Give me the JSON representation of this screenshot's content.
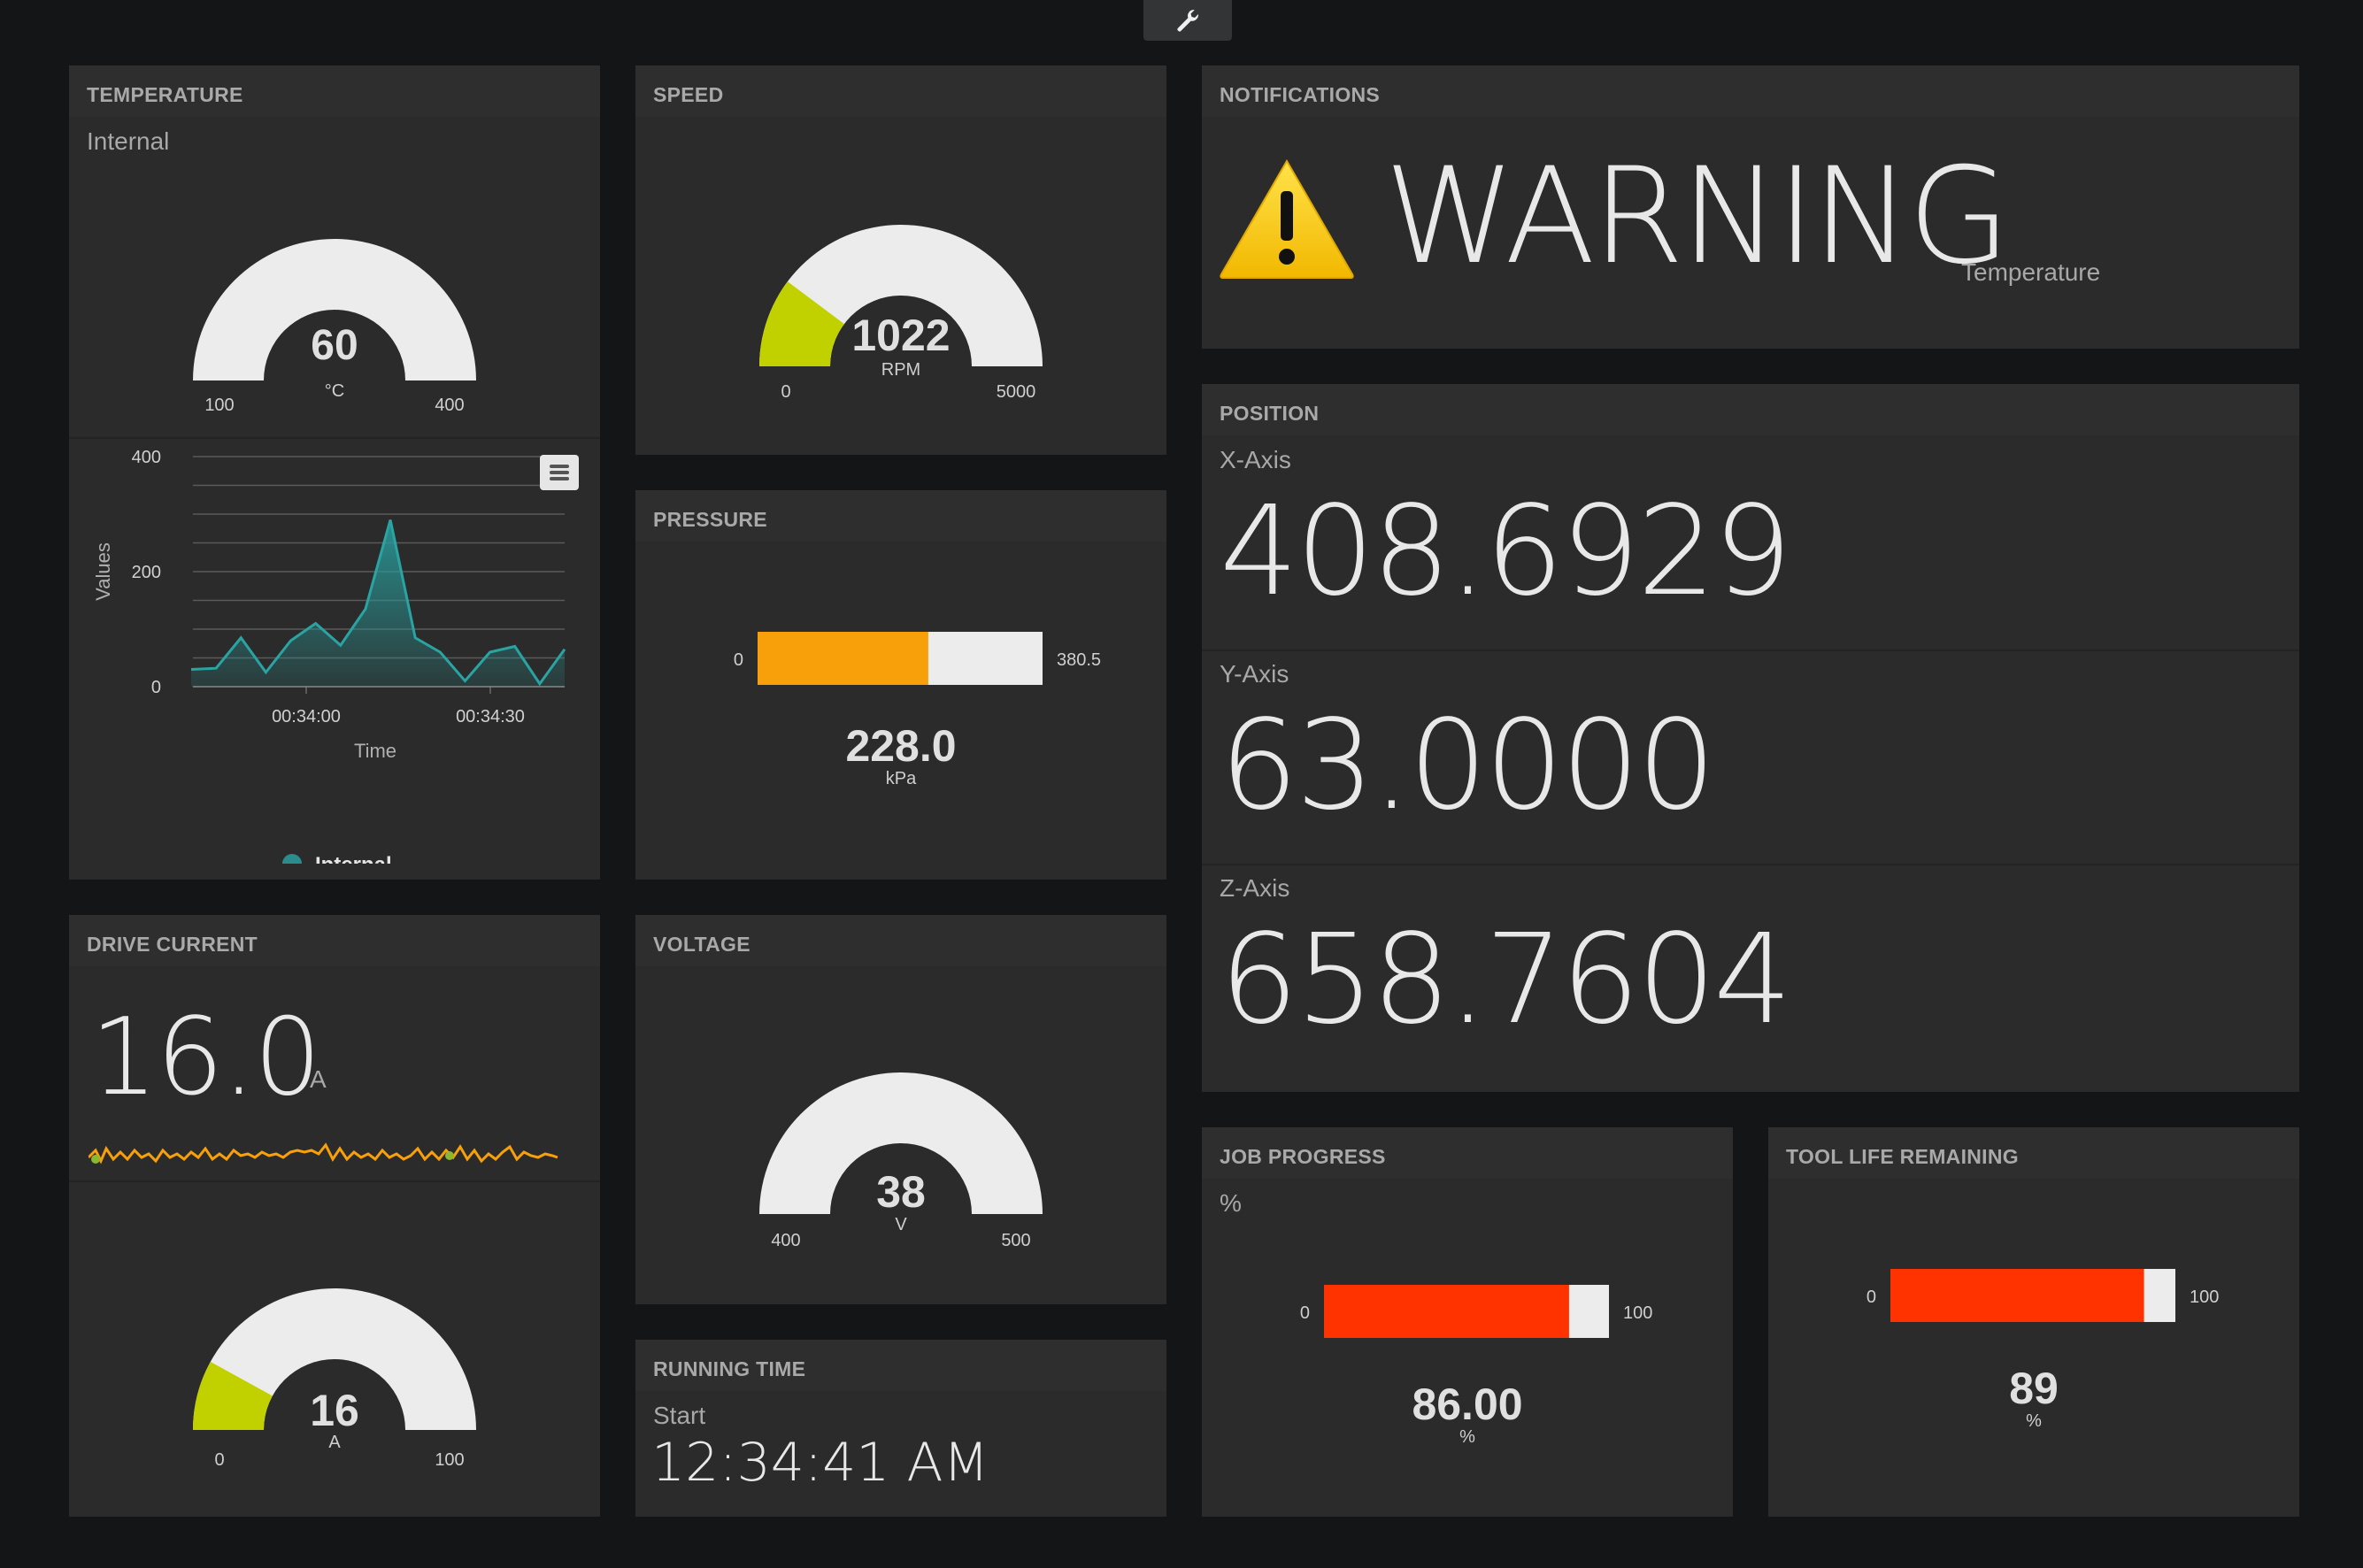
{
  "colors": {
    "bg": "#141517",
    "panel": "#2b2b2b",
    "gauge_bg": "#ececec",
    "green": "#c1d100",
    "orange": "#f7a00a",
    "red": "#ff3300",
    "teal": "#2a8c8c"
  },
  "toolbar": {
    "icon": "wrench-icon"
  },
  "temperature": {
    "title": "TEMPERATURE",
    "subtitle": "Internal",
    "gauge": {
      "value": "60",
      "unit": "°C",
      "min": "100",
      "max": "400",
      "fraction": 0
    },
    "chart_data": {
      "type": "area",
      "x": [
        "00:33:50",
        "00:33:53",
        "00:33:57",
        "00:34:00",
        "00:34:03",
        "00:34:07",
        "00:34:10",
        "00:34:13",
        "00:34:17",
        "00:34:20",
        "00:34:24",
        "00:34:27",
        "00:34:30",
        "00:34:33",
        "00:34:37",
        "00:34:40"
      ],
      "series": [
        {
          "name": "Internal",
          "values": [
            30,
            32,
            85,
            25,
            80,
            110,
            72,
            135,
            290,
            85,
            60,
            10,
            60,
            70,
            5,
            65
          ]
        }
      ],
      "x_ticks": [
        "00:34:00",
        "00:34:30"
      ],
      "y_ticks": [
        "0",
        "200",
        "400"
      ],
      "xlabel": "Time",
      "ylabel": "Values",
      "ylim": [
        0,
        400
      ],
      "grid": true,
      "legend": "bottom"
    },
    "menu_icon": "hamburger-menu-icon"
  },
  "speed": {
    "title": "SPEED",
    "value": "1022",
    "unit": "RPM",
    "min": "0",
    "max": "5000",
    "fraction": 0.2044
  },
  "pressure": {
    "title": "PRESSURE",
    "value": "228.0",
    "unit": "kPa",
    "min": "0",
    "max": "380.5",
    "fraction": 0.599
  },
  "voltage": {
    "title": "VOLTAGE",
    "value": "38",
    "unit": "V",
    "min": "400",
    "max": "500",
    "fraction": 0
  },
  "running_time": {
    "title": "RUNNING TIME",
    "label": "Start",
    "value": "12:34:41 AM"
  },
  "notifications": {
    "title": "NOTIFICATIONS",
    "icon": "warning-icon",
    "message": "WARNING",
    "detail": "Temperature"
  },
  "position": {
    "title": "POSITION",
    "axes": [
      {
        "label": "X-Axis",
        "value": "408.6929"
      },
      {
        "label": "Y-Axis",
        "value": "63.0000"
      },
      {
        "label": "Z-Axis",
        "value": "658.7604"
      }
    ]
  },
  "drive_current": {
    "title": "DRIVE CURRENT",
    "value": "16.0",
    "unit": "A",
    "gauge": {
      "value": "16",
      "unit": "A",
      "min": "0",
      "max": "100",
      "fraction": 0.16
    }
  },
  "job_progress": {
    "title": "JOB PROGRESS",
    "subtitle": "%",
    "value": "86.00",
    "unit": "%",
    "min": "0",
    "max": "100",
    "fraction": 0.86
  },
  "tool_life": {
    "title": "TOOL LIFE REMAINING",
    "value": "89",
    "unit": "%",
    "min": "0",
    "max": "100",
    "fraction": 0.89
  }
}
